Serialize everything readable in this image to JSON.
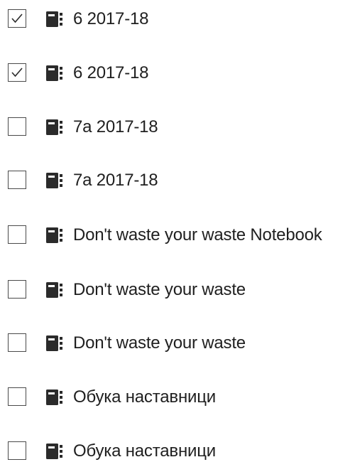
{
  "notebooks": [
    {
      "label": "6 2017-18",
      "checked": true
    },
    {
      "label": "6 2017-18",
      "checked": true
    },
    {
      "label": "7a 2017-18",
      "checked": false
    },
    {
      "label": "7a 2017-18",
      "checked": false
    },
    {
      "label": "Don't waste your waste Notebook",
      "checked": false
    },
    {
      "label": "Don't waste your waste",
      "checked": false
    },
    {
      "label": "Don't waste your waste",
      "checked": false
    },
    {
      "label": "Обука наставници",
      "checked": false
    },
    {
      "label": "Обука наставници",
      "checked": false
    }
  ],
  "icons": {
    "checkbox_mark": "checkmark-icon",
    "item_icon": "notebook-icon"
  },
  "colors": {
    "text": "#1f1f1f",
    "icon": "#2b2b2b",
    "checkbox_border": "#4a4a4a"
  }
}
